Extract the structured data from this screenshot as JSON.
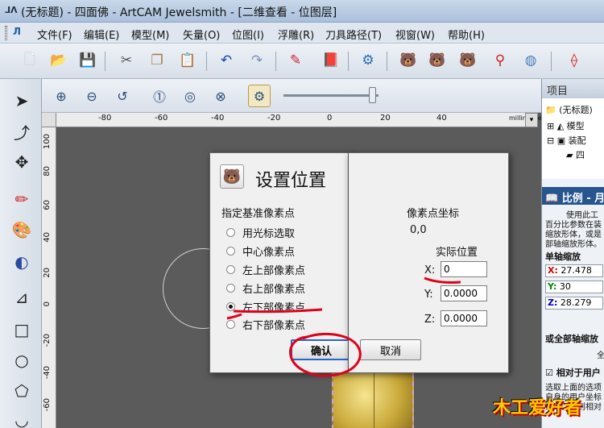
{
  "window": {
    "title": "(无标题) - 四面佛 - ArtCAM Jewelsmith - [二维查看 - 位图层]"
  },
  "menu": [
    "文件(F)",
    "编辑(E)",
    "模型(M)",
    "矢量(O)",
    "位图(I)",
    "浮雕(R)",
    "刀具路径(T)",
    "视窗(W)",
    "帮助(H)"
  ],
  "ruler": {
    "top_ticks": [
      "-80",
      "-60",
      "-40",
      "-20",
      "0",
      "20",
      "40"
    ],
    "units": "millimetres",
    "left_ticks": [
      "100",
      "80",
      "60",
      "40",
      "20",
      "0",
      "-20",
      "-40",
      "-60"
    ]
  },
  "project_panel": {
    "header": "项目",
    "tree": [
      "(无标题)",
      "模型",
      "装配",
      "四"
    ],
    "section": "比例 - 月",
    "desc": [
      "使用此工",
      "百分比参数在装",
      "缩放形体，或是",
      "部轴缩放形体。"
    ],
    "single_axis": "单轴缩放",
    "fields": [
      {
        "axis": "X:",
        "value": "27.478"
      },
      {
        "axis": "Y:",
        "value": "30"
      },
      {
        "axis": "Z:",
        "value": "28.279"
      }
    ],
    "all_axis": "或全部轴缩放",
    "all_axis_value": "全",
    "relative_label": "相对于用户",
    "relative_desc": [
      "选取上面的选项",
      "自身的用户坐标",
      "运动。否则相对"
    ]
  },
  "dialog": {
    "title": "设置位置",
    "group_label": "指定基准像素点",
    "coord_label": "像素点坐标",
    "coord_value": "0,0",
    "actual_label": "实际位置",
    "options": [
      "用光标选取",
      "中心像素点",
      "左上部像素点",
      "右上部像素点",
      "左下部像素点",
      "右下部像素点"
    ],
    "selected_option": "左下部像素点",
    "x_label": "X:",
    "x_value": "0",
    "y_label": "Y:",
    "y_value": "0.0000",
    "z_label": "Z:",
    "z_value": "0.0000",
    "ok": "确认",
    "cancel": "取消"
  },
  "watermark": "木工爱好者",
  "colors": {
    "annotation": "#e0001b",
    "dialog_bg": "#f0f0f0",
    "panel_section": "#26558f"
  }
}
